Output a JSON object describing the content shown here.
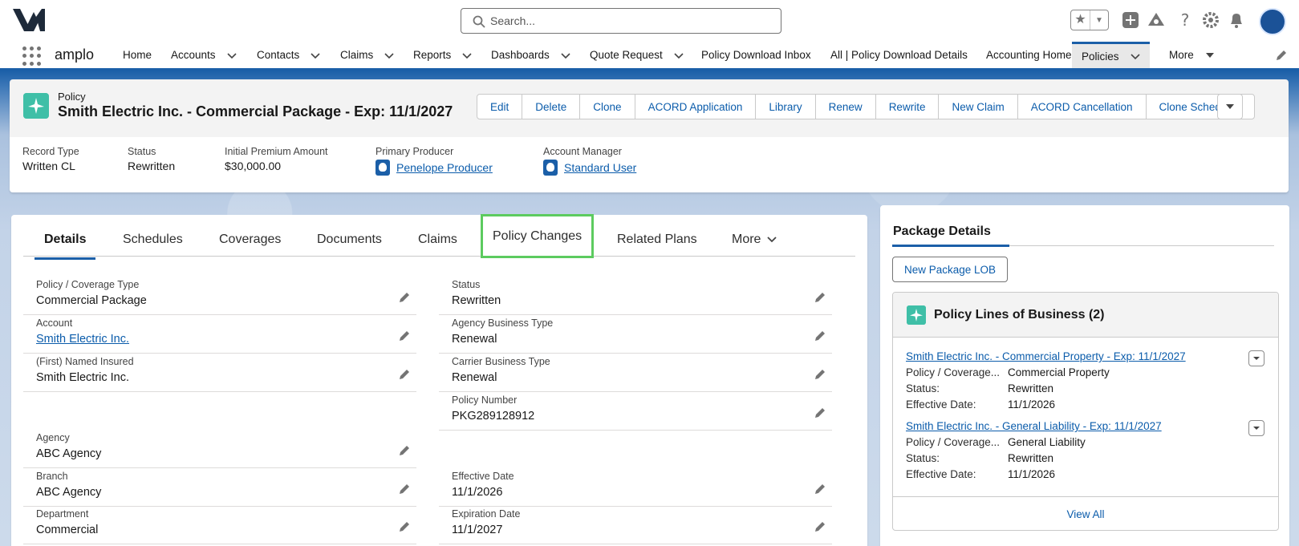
{
  "header": {
    "search_placeholder": "Search...",
    "app_name": "amplo"
  },
  "nav": {
    "items": [
      {
        "label": "Home",
        "chevron": false
      },
      {
        "label": "Accounts",
        "chevron": true
      },
      {
        "label": "Contacts",
        "chevron": true
      },
      {
        "label": "Claims",
        "chevron": true
      },
      {
        "label": "Reports",
        "chevron": true
      },
      {
        "label": "Dashboards",
        "chevron": true
      },
      {
        "label": "Quote Request",
        "chevron": true
      },
      {
        "label": "Policy Download Inbox",
        "chevron": false
      },
      {
        "label": "All | Policy Download Details",
        "chevron": false
      },
      {
        "label": "Accounting Home",
        "chevron": false
      },
      {
        "label": "Policies",
        "chevron": true,
        "active": true
      },
      {
        "label": "More",
        "chevron": true
      }
    ]
  },
  "record": {
    "object_type": "Policy",
    "title": "Smith Electric Inc. - Commercial Package - Exp: 11/1/2027",
    "actions": [
      "Edit",
      "Delete",
      "Clone",
      "ACORD Application",
      "Library",
      "Renew",
      "Rewrite",
      "New Claim",
      "ACORD Cancellation",
      "Clone Schedules"
    ],
    "highlights": [
      {
        "label": "Record Type",
        "value": "Written CL"
      },
      {
        "label": "Status",
        "value": "Rewritten"
      },
      {
        "label": "Initial Premium Amount",
        "value": "$30,000.00"
      },
      {
        "label": "Primary Producer",
        "value": "Penelope Producer"
      },
      {
        "label": "Account Manager",
        "value": "Standard User"
      }
    ]
  },
  "tabs": [
    "Details",
    "Schedules",
    "Coverages",
    "Documents",
    "Claims",
    "Policy Changes",
    "Related Plans",
    "More"
  ],
  "details": {
    "left": [
      {
        "label": "Policy / Coverage Type",
        "value": "Commercial Package"
      },
      {
        "label": "Account",
        "value": "Smith Electric Inc."
      },
      {
        "label": "(First) Named Insured",
        "value": "Smith Electric Inc."
      },
      {
        "label": "Agency",
        "value": "ABC Agency"
      },
      {
        "label": "Branch",
        "value": "ABC Agency"
      },
      {
        "label": "Department",
        "value": "Commercial"
      }
    ],
    "right": [
      {
        "label": "Status",
        "value": "Rewritten"
      },
      {
        "label": "Agency Business Type",
        "value": "Renewal"
      },
      {
        "label": "Carrier Business Type",
        "value": "Renewal"
      },
      {
        "label": "Policy Number",
        "value": "PKG289128912"
      },
      {
        "label": "Effective Date",
        "value": "11/1/2026"
      },
      {
        "label": "Expiration Date",
        "value": "11/1/2027"
      }
    ]
  },
  "package": {
    "tab": "Package Details",
    "new_button": "New Package LOB",
    "related_title": "Policy Lines of Business (2)",
    "records": [
      {
        "link": "Smith Electric Inc. - Commercial Property - Exp: 11/1/2027",
        "rows": [
          {
            "k": "Policy / Coverage...",
            "v": "Commercial Property"
          },
          {
            "k": "Status:",
            "v": "Rewritten"
          },
          {
            "k": "Effective Date:",
            "v": "11/1/2026"
          }
        ]
      },
      {
        "link": "Smith Electric Inc. - General Liability - Exp: 11/1/2027",
        "rows": [
          {
            "k": "Policy / Coverage...",
            "v": "General Liability"
          },
          {
            "k": "Status:",
            "v": "Rewritten"
          },
          {
            "k": "Effective Date:",
            "v": "11/1/2026"
          }
        ]
      }
    ],
    "view_all": "View All"
  },
  "colors": {
    "brand": "#1b5fa8",
    "link": "#0b5cab",
    "object_icon": "#3fbfa7",
    "tab_highlight": "#5ccb5f"
  }
}
